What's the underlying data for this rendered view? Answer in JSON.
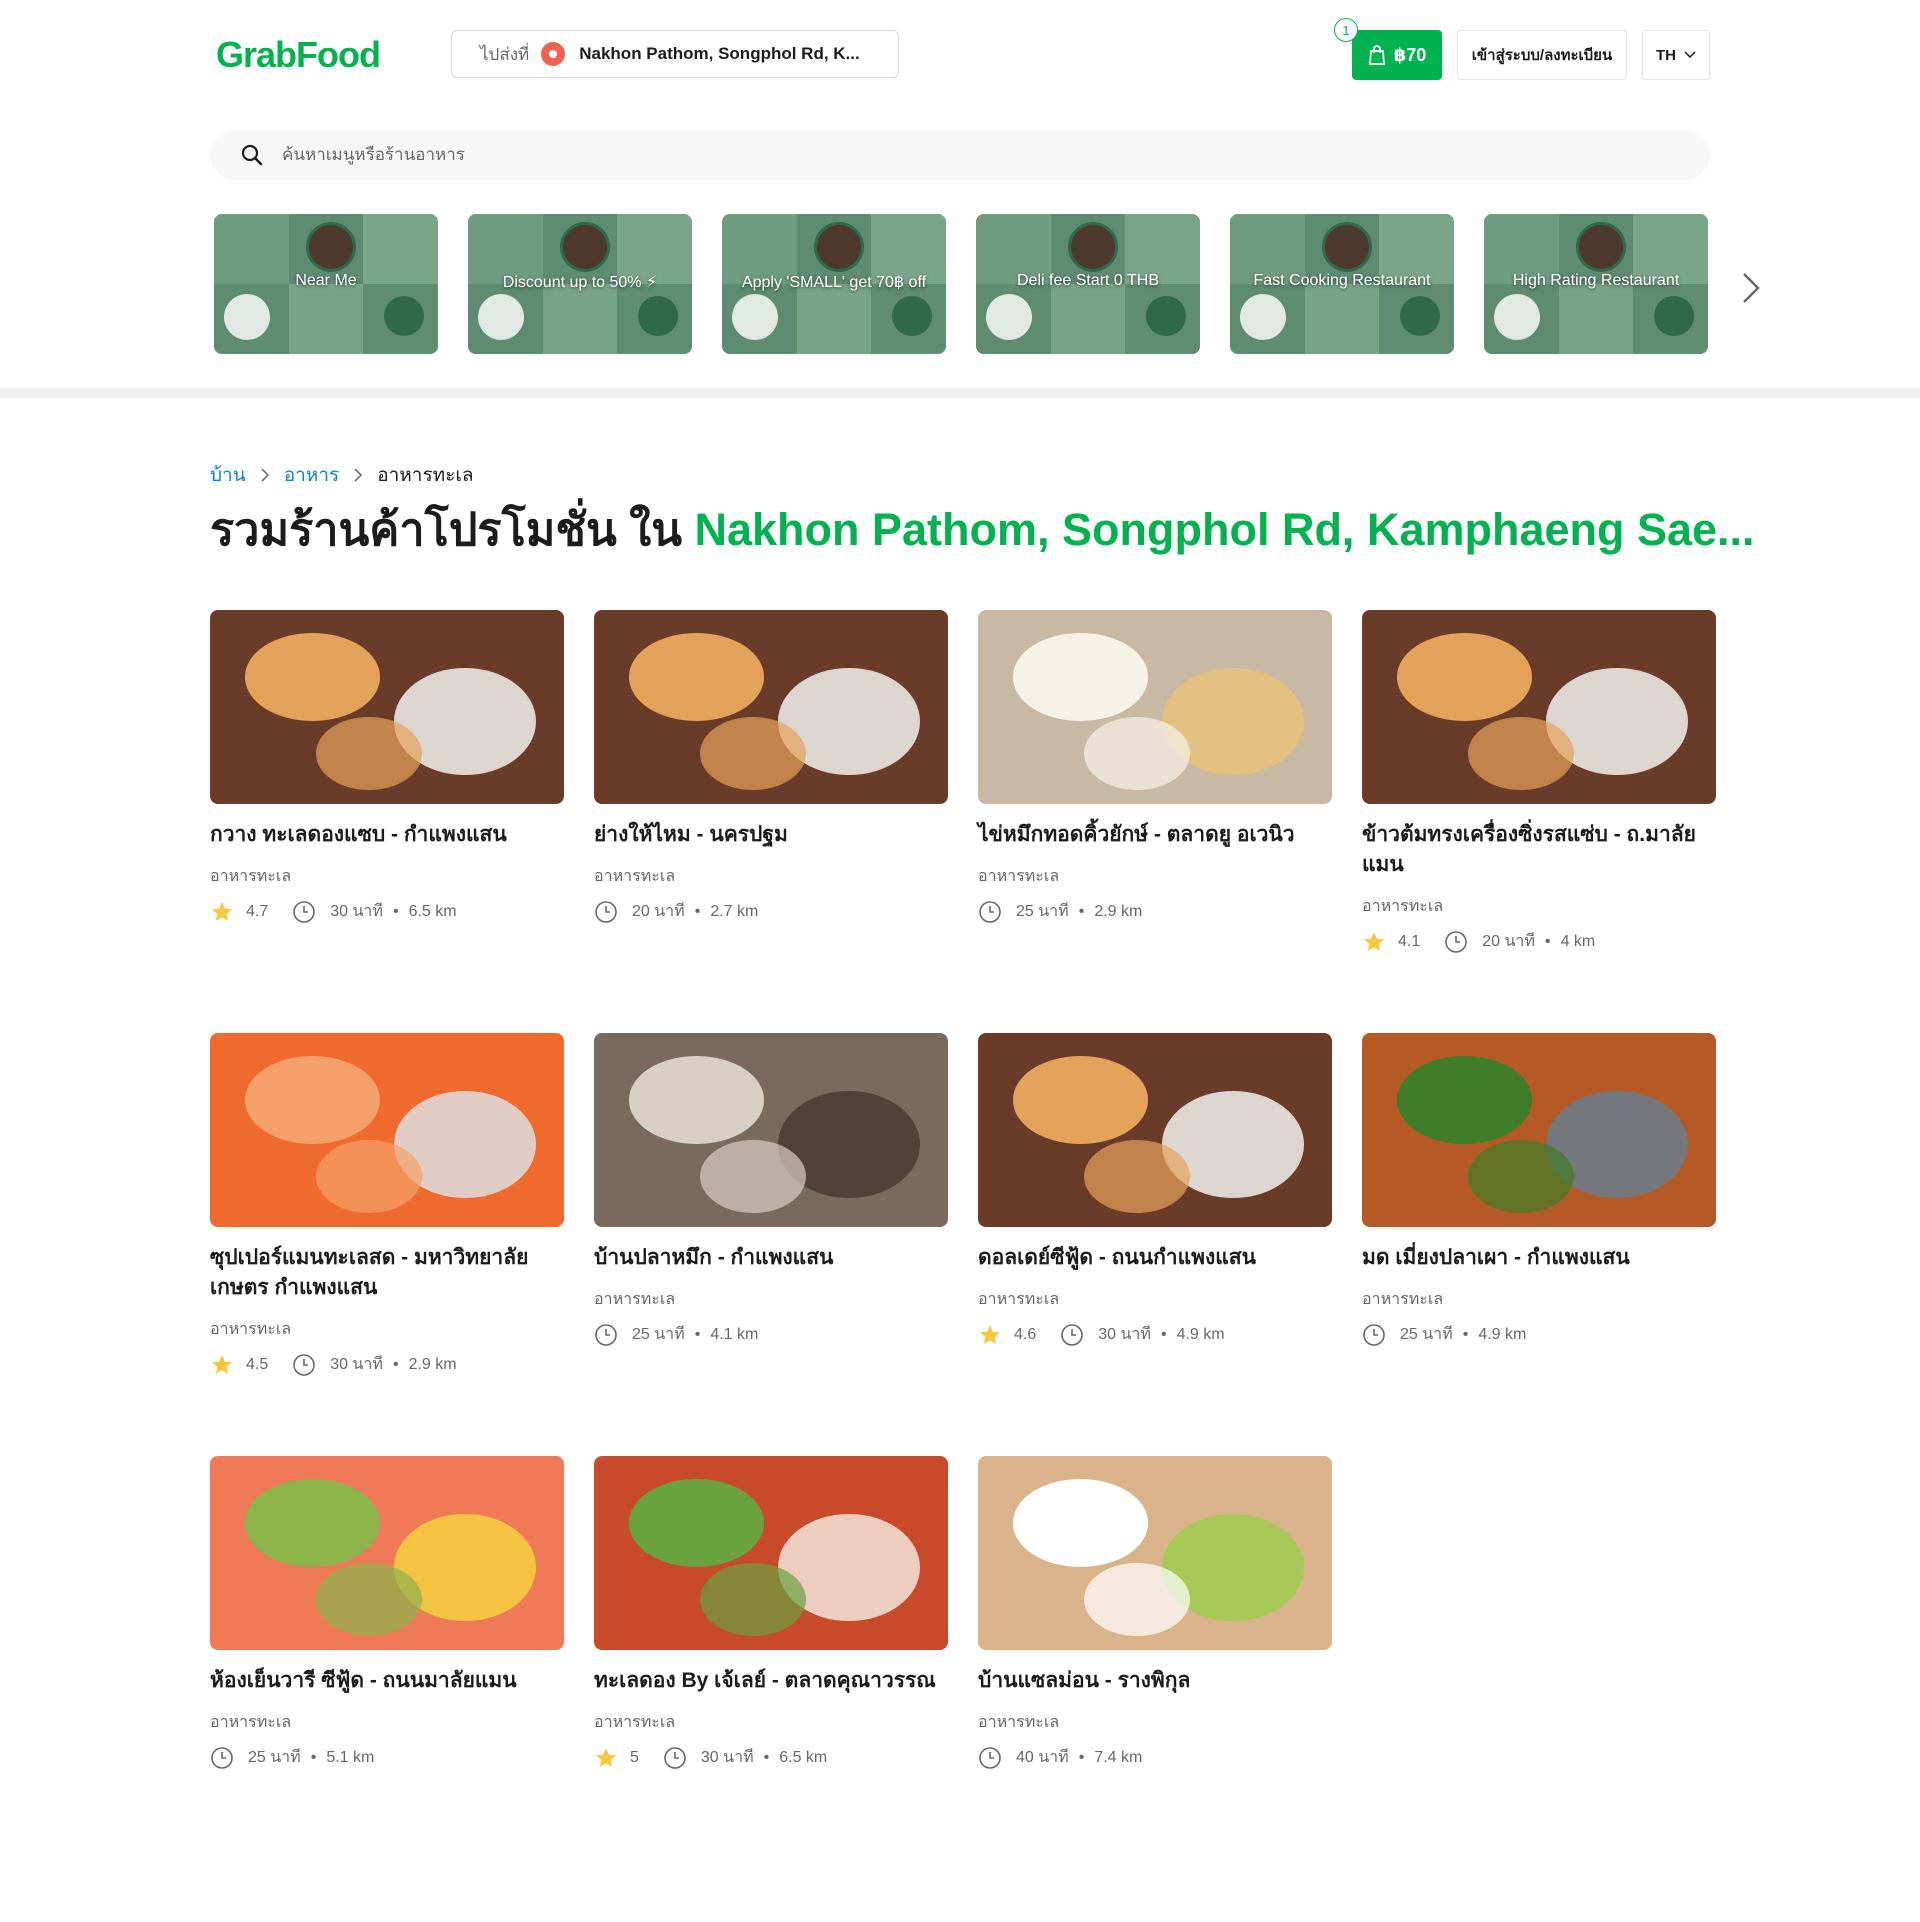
{
  "header": {
    "logo": "GrabFood",
    "deliver_to_label": "ไปส่งที่",
    "location": "Nakhon Pathom, Songphol Rd, K...",
    "cart_count": "1",
    "cart_amount": "฿70",
    "login_label": "เข้าสู่ระบบ/ลงทะเบียน",
    "lang": "TH"
  },
  "search": {
    "placeholder": "ค้นหาเมนูหรือร้านอาหาร"
  },
  "promos": [
    {
      "label": "Near Me"
    },
    {
      "label": "Discount up to 50% ⚡"
    },
    {
      "label": "Apply 'SMALL' get 70฿ off"
    },
    {
      "label": "Deli fee Start 0 THB"
    },
    {
      "label": "Fast Cooking Restaurant"
    },
    {
      "label": "High Rating Restaurant"
    }
  ],
  "breadcrumb": {
    "home": "บ้าน",
    "food": "อาหาร",
    "current": "อาหารทะเล"
  },
  "title": {
    "prefix": "รวมร้านค้าโปรโมชั่น ใน",
    "location": "Nakhon Pathom, Songphol Rd, Kamphaeng Sae..."
  },
  "restaurants": [
    {
      "name": "กวาง ทะเลดองแซบ - กำแพงแสน",
      "cuisine": "อาหารทะเล",
      "rating": "4.7",
      "time": "30 นาที",
      "distance": "6.5 km"
    },
    {
      "name": "ย่างให้ไหม - นครปฐม",
      "cuisine": "อาหารทะเล",
      "rating": "",
      "time": "20 นาที",
      "distance": "2.7 km"
    },
    {
      "name": "ไข่หมึกทอดคิ้วยักษ์ - ตลาดยู อเวนิว",
      "cuisine": "อาหารทะเล",
      "rating": "",
      "time": "25 นาที",
      "distance": "2.9 km"
    },
    {
      "name": "ข้าวต้มทรงเครื่องซิ่งรสแซ่บ - ถ.มาลัยแมน",
      "cuisine": "อาหารทะเล",
      "rating": "4.1",
      "time": "20 นาที",
      "distance": "4 km"
    },
    {
      "name": "ซุปเปอร์แมนทะเลสด - มหาวิทยาลัยเกษตร กำแพงแสน",
      "cuisine": "อาหารทะเล",
      "rating": "4.5",
      "time": "30 นาที",
      "distance": "2.9 km"
    },
    {
      "name": "บ้านปลาหมึก - กำแพงแสน",
      "cuisine": "อาหารทะเล",
      "rating": "",
      "time": "25 นาที",
      "distance": "4.1 km"
    },
    {
      "name": "ดอลเดย์ซีฟู้ด - ถนนกำแพงแสน",
      "cuisine": "อาหารทะเล",
      "rating": "4.6",
      "time": "30 นาที",
      "distance": "4.9 km"
    },
    {
      "name": "มด เมี่ยงปลาเผา - กำแพงแสน",
      "cuisine": "อาหารทะเล",
      "rating": "",
      "time": "25 นาที",
      "distance": "4.9 km"
    },
    {
      "name": "ห้องเย็นวารี ซีฟู้ด - ถนนมาลัยแมน",
      "cuisine": "อาหารทะเล",
      "rating": "",
      "time": "25 นาที",
      "distance": "5.1 km"
    },
    {
      "name": "ทะเลดอง By เจ้เลย์ - ตลาดคุณาวรรณ",
      "cuisine": "อาหารทะเล",
      "rating": "5",
      "time": "30 นาที",
      "distance": "6.5 km"
    },
    {
      "name": "บ้านแซลม่อน - รางพิกุล",
      "cuisine": "อาหารทะเล",
      "rating": "",
      "time": "40 นาที",
      "distance": "7.4 km"
    }
  ],
  "colors": {
    "brand": "#00b14f",
    "link": "#0a84c6",
    "star": "#f7c942"
  }
}
